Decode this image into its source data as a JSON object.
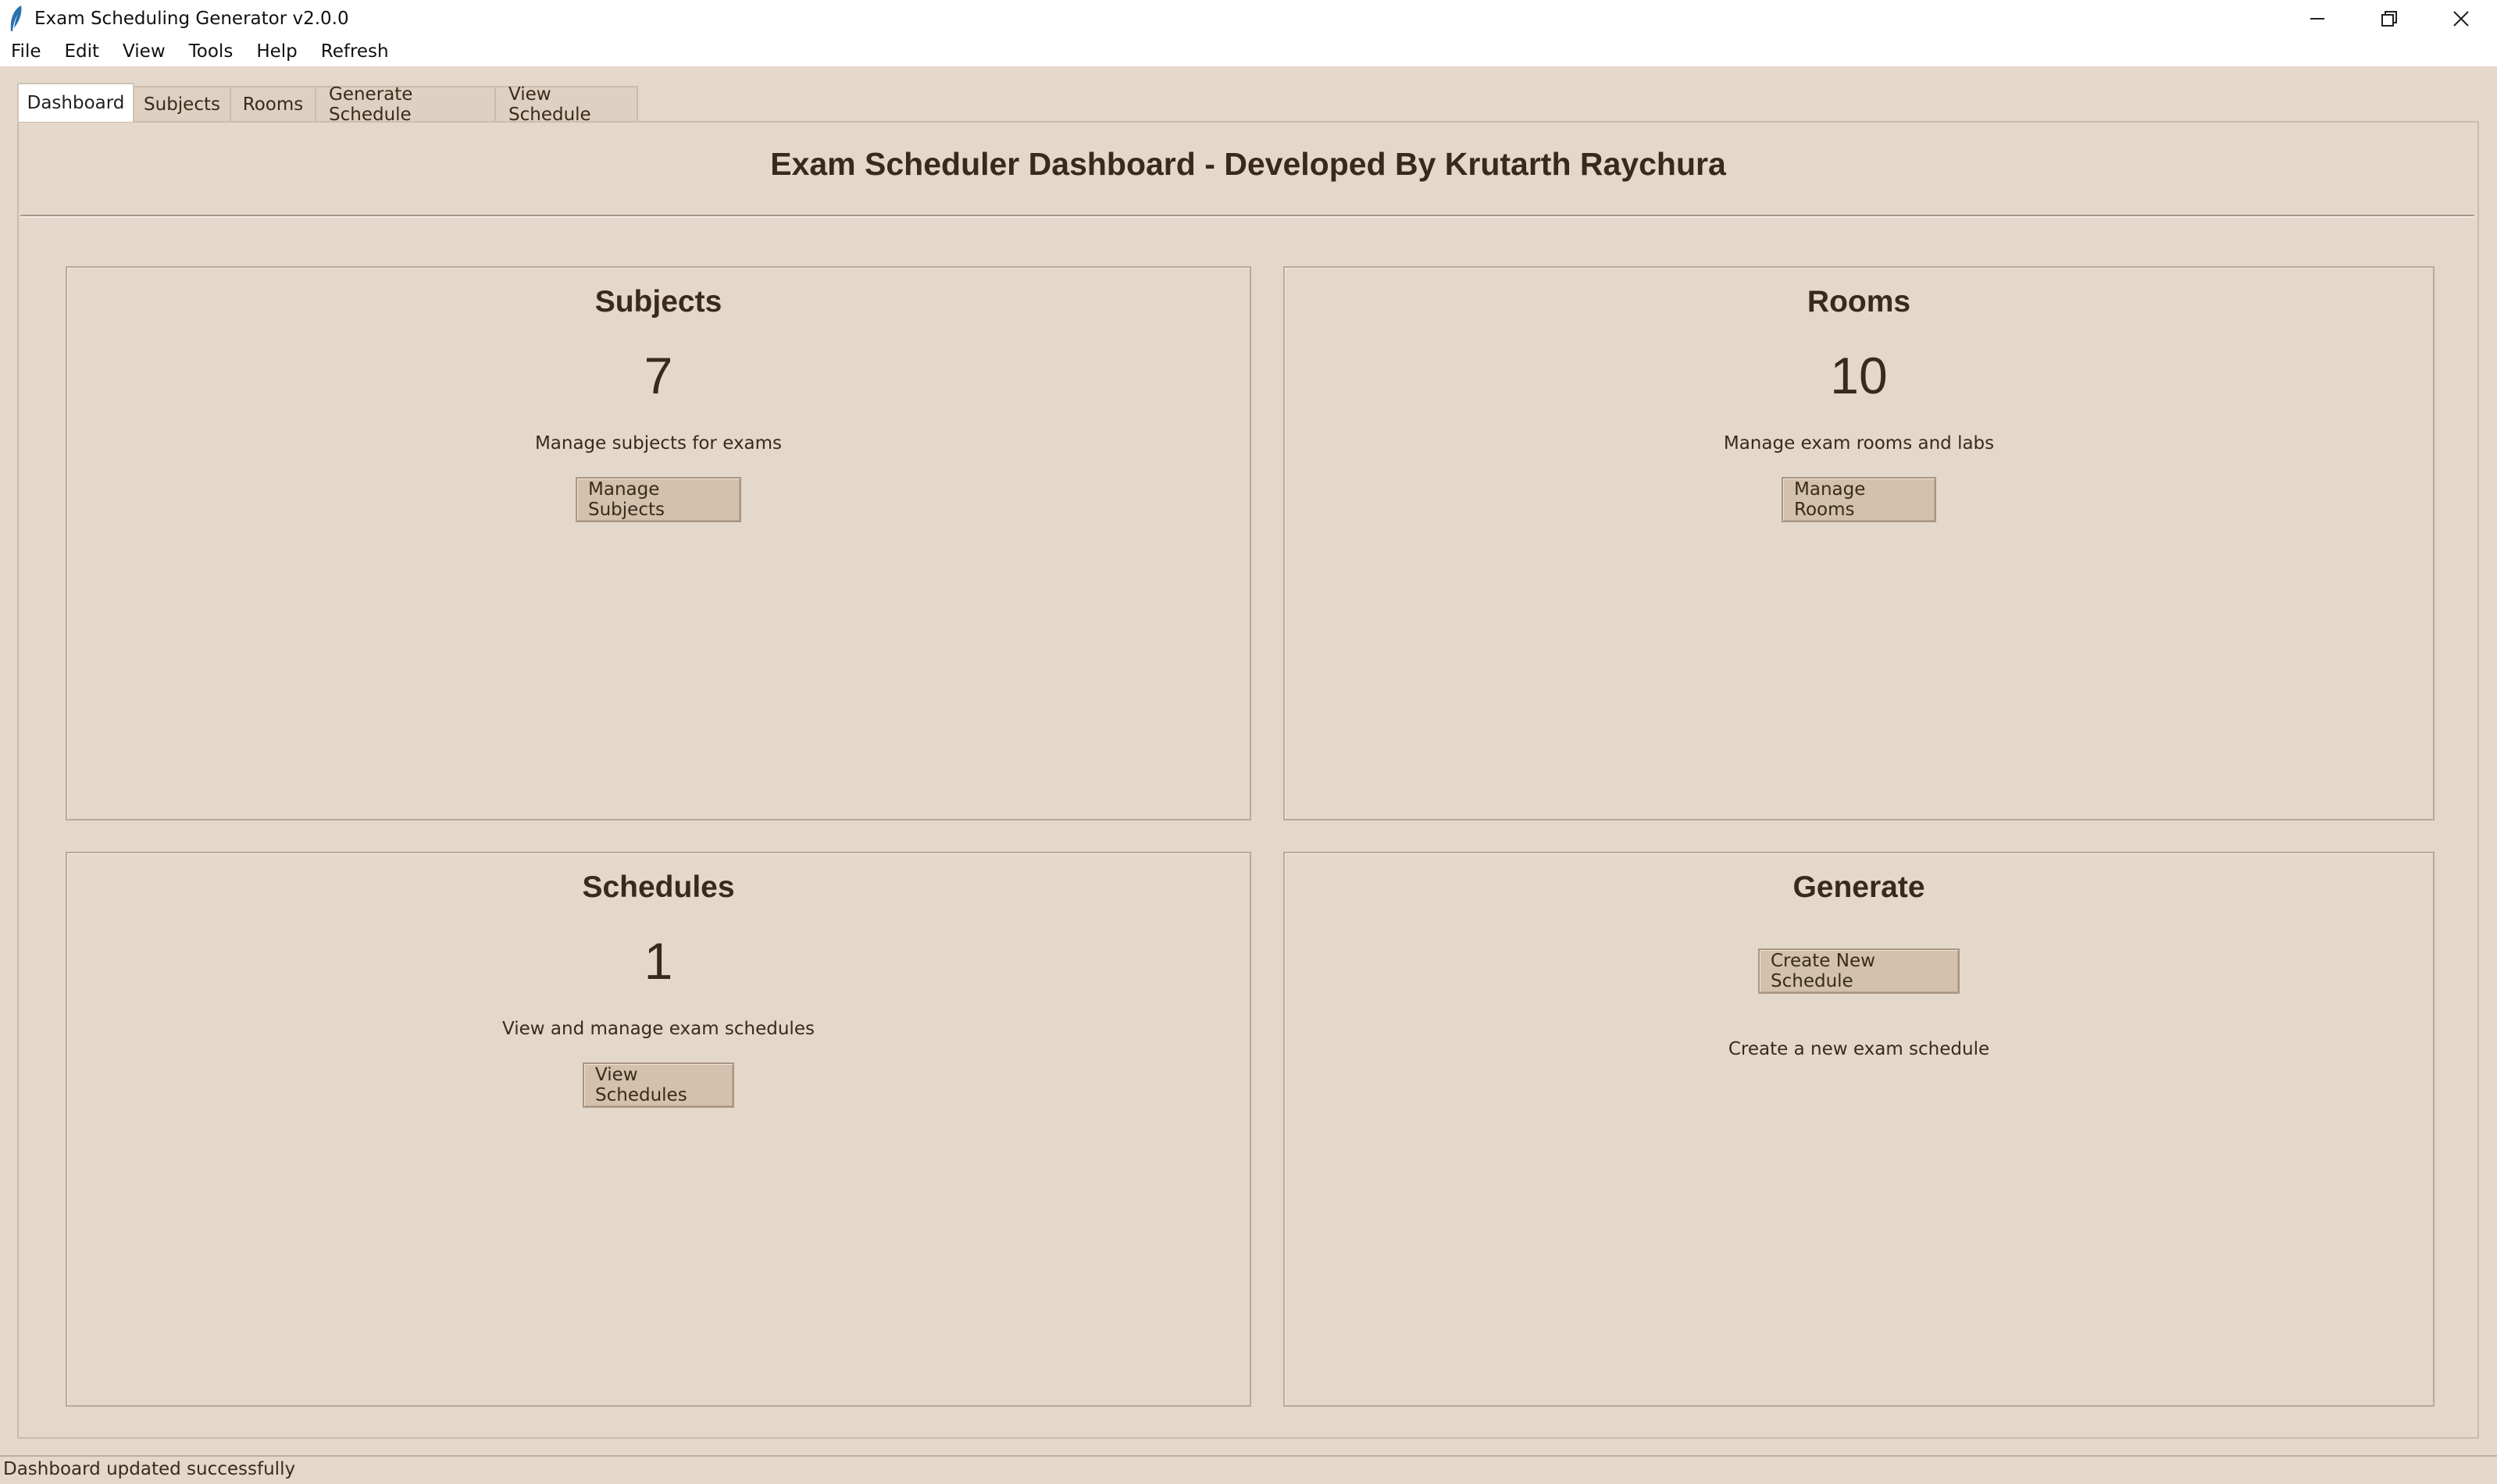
{
  "window": {
    "title": "Exam Scheduling Generator v2.0.0"
  },
  "menu": [
    "File",
    "Edit",
    "View",
    "Tools",
    "Help",
    "Refresh"
  ],
  "tabs": [
    {
      "label": "Dashboard",
      "active": true
    },
    {
      "label": "Subjects",
      "active": false
    },
    {
      "label": "Rooms",
      "active": false
    },
    {
      "label": "Generate Schedule",
      "active": false
    },
    {
      "label": "View Schedule",
      "active": false
    }
  ],
  "dashboard": {
    "title": "Exam Scheduler Dashboard - Developed By Krutarth Raychura",
    "cards": {
      "subjects": {
        "title": "Subjects",
        "count": "7",
        "description": "Manage subjects for exams",
        "button": "Manage Subjects"
      },
      "rooms": {
        "title": "Rooms",
        "count": "10",
        "description": "Manage exam rooms and labs",
        "button": "Manage Rooms"
      },
      "schedules": {
        "title": "Schedules",
        "count": "1",
        "description": "View and manage exam schedules",
        "button": "View Schedules"
      },
      "generate": {
        "title": "Generate",
        "button": "Create New Schedule",
        "description": "Create a new exam schedule"
      }
    }
  },
  "status": "Dashboard updated successfully",
  "icons": {
    "app": "feather-icon",
    "minimize": "minimize-icon",
    "restore": "restore-icon",
    "close": "close-icon"
  }
}
